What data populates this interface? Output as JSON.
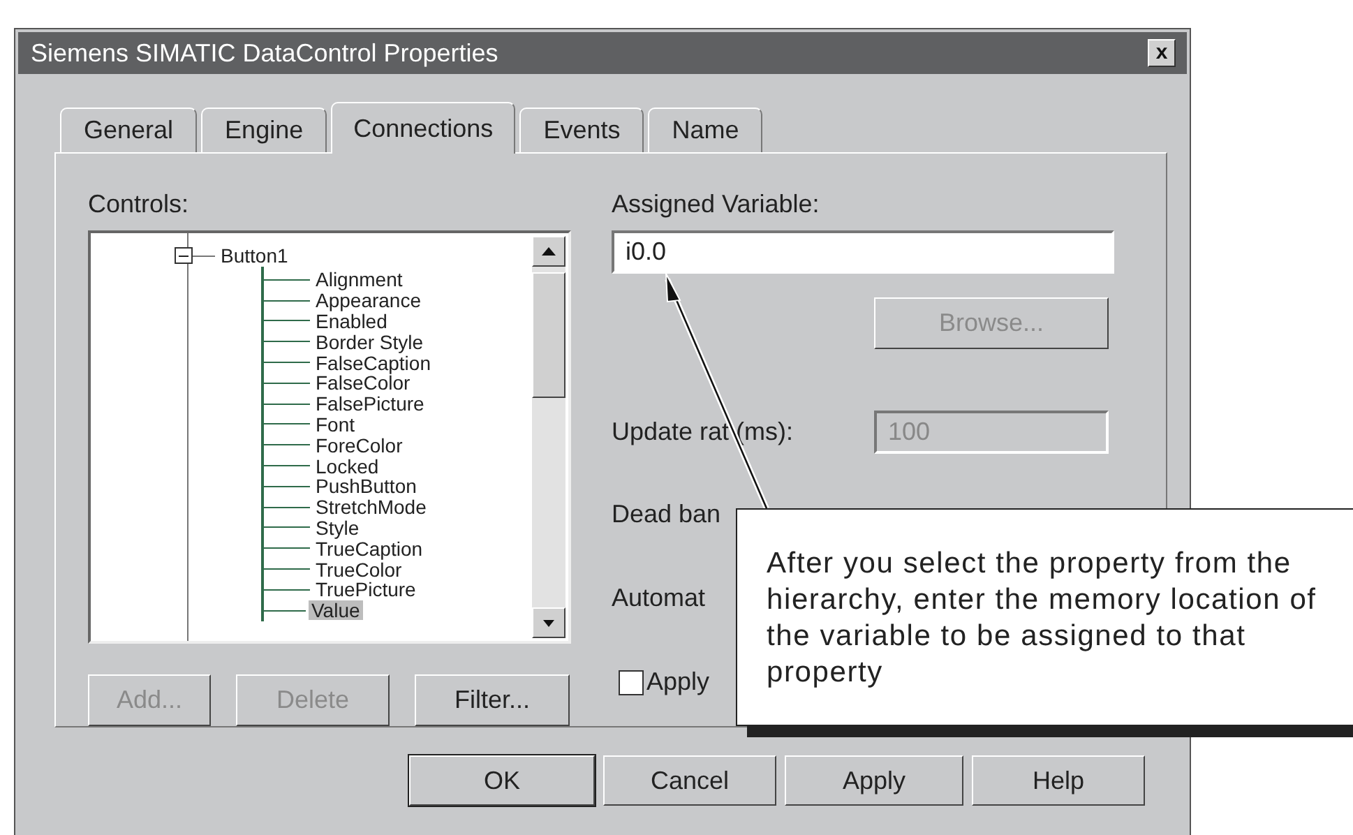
{
  "window": {
    "title": "Siemens SIMATIC DataControl Properties",
    "close_label": "x"
  },
  "tabs": [
    {
      "label": "General",
      "selected": false
    },
    {
      "label": "Engine",
      "selected": false
    },
    {
      "label": "Connections",
      "selected": true
    },
    {
      "label": "Events",
      "selected": false
    },
    {
      "label": "Name",
      "selected": false
    }
  ],
  "controls": {
    "label": "Controls:",
    "tree": [
      {
        "label": "Button1",
        "expanded": true,
        "selected": false,
        "children": [
          {
            "label": "Alignment",
            "selected": false
          },
          {
            "label": "Appearance",
            "selected": false
          },
          {
            "label": "Enabled",
            "selected": false
          },
          {
            "label": "Border Style",
            "selected": false
          },
          {
            "label": "FalseCaption",
            "selected": false
          },
          {
            "label": "FalseColor",
            "selected": false
          },
          {
            "label": "FalsePicture",
            "selected": false
          },
          {
            "label": "Font",
            "selected": false
          },
          {
            "label": "ForeColor",
            "selected": false
          },
          {
            "label": "Locked",
            "selected": false
          },
          {
            "label": "PushButton",
            "selected": false
          },
          {
            "label": "StretchMode",
            "selected": false
          },
          {
            "label": "Style",
            "selected": false
          },
          {
            "label": "TrueCaption",
            "selected": false
          },
          {
            "label": "TrueColor",
            "selected": false
          },
          {
            "label": "TruePicture",
            "selected": false
          },
          {
            "label": "Value",
            "selected": true
          }
        ]
      }
    ]
  },
  "tree_buttons": [
    {
      "label": "Add...",
      "disabled": true
    },
    {
      "label": "Delete",
      "disabled": true
    },
    {
      "label": "Filter...",
      "disabled": false
    }
  ],
  "assigned_variable": {
    "label": "Assigned Variable:",
    "value": "i0.0"
  },
  "browse_button": {
    "label": "Browse...",
    "disabled": true
  },
  "update_rate": {
    "label": "Update rat (ms):",
    "value": "100",
    "disabled": true
  },
  "dead_band": {
    "label": "Dead ban"
  },
  "automatic": {
    "label": "Automat"
  },
  "apply_checkbox": {
    "label": "Apply",
    "checked": false
  },
  "dialog_buttons": [
    {
      "label": "OK",
      "default": true
    },
    {
      "label": "Cancel",
      "default": false
    },
    {
      "label": "Apply",
      "default": false
    },
    {
      "label": "Help",
      "default": false
    }
  ],
  "callout": {
    "text": "After you select the property from the hierarchy, enter the memory location of the variable to be assigned to that property"
  }
}
